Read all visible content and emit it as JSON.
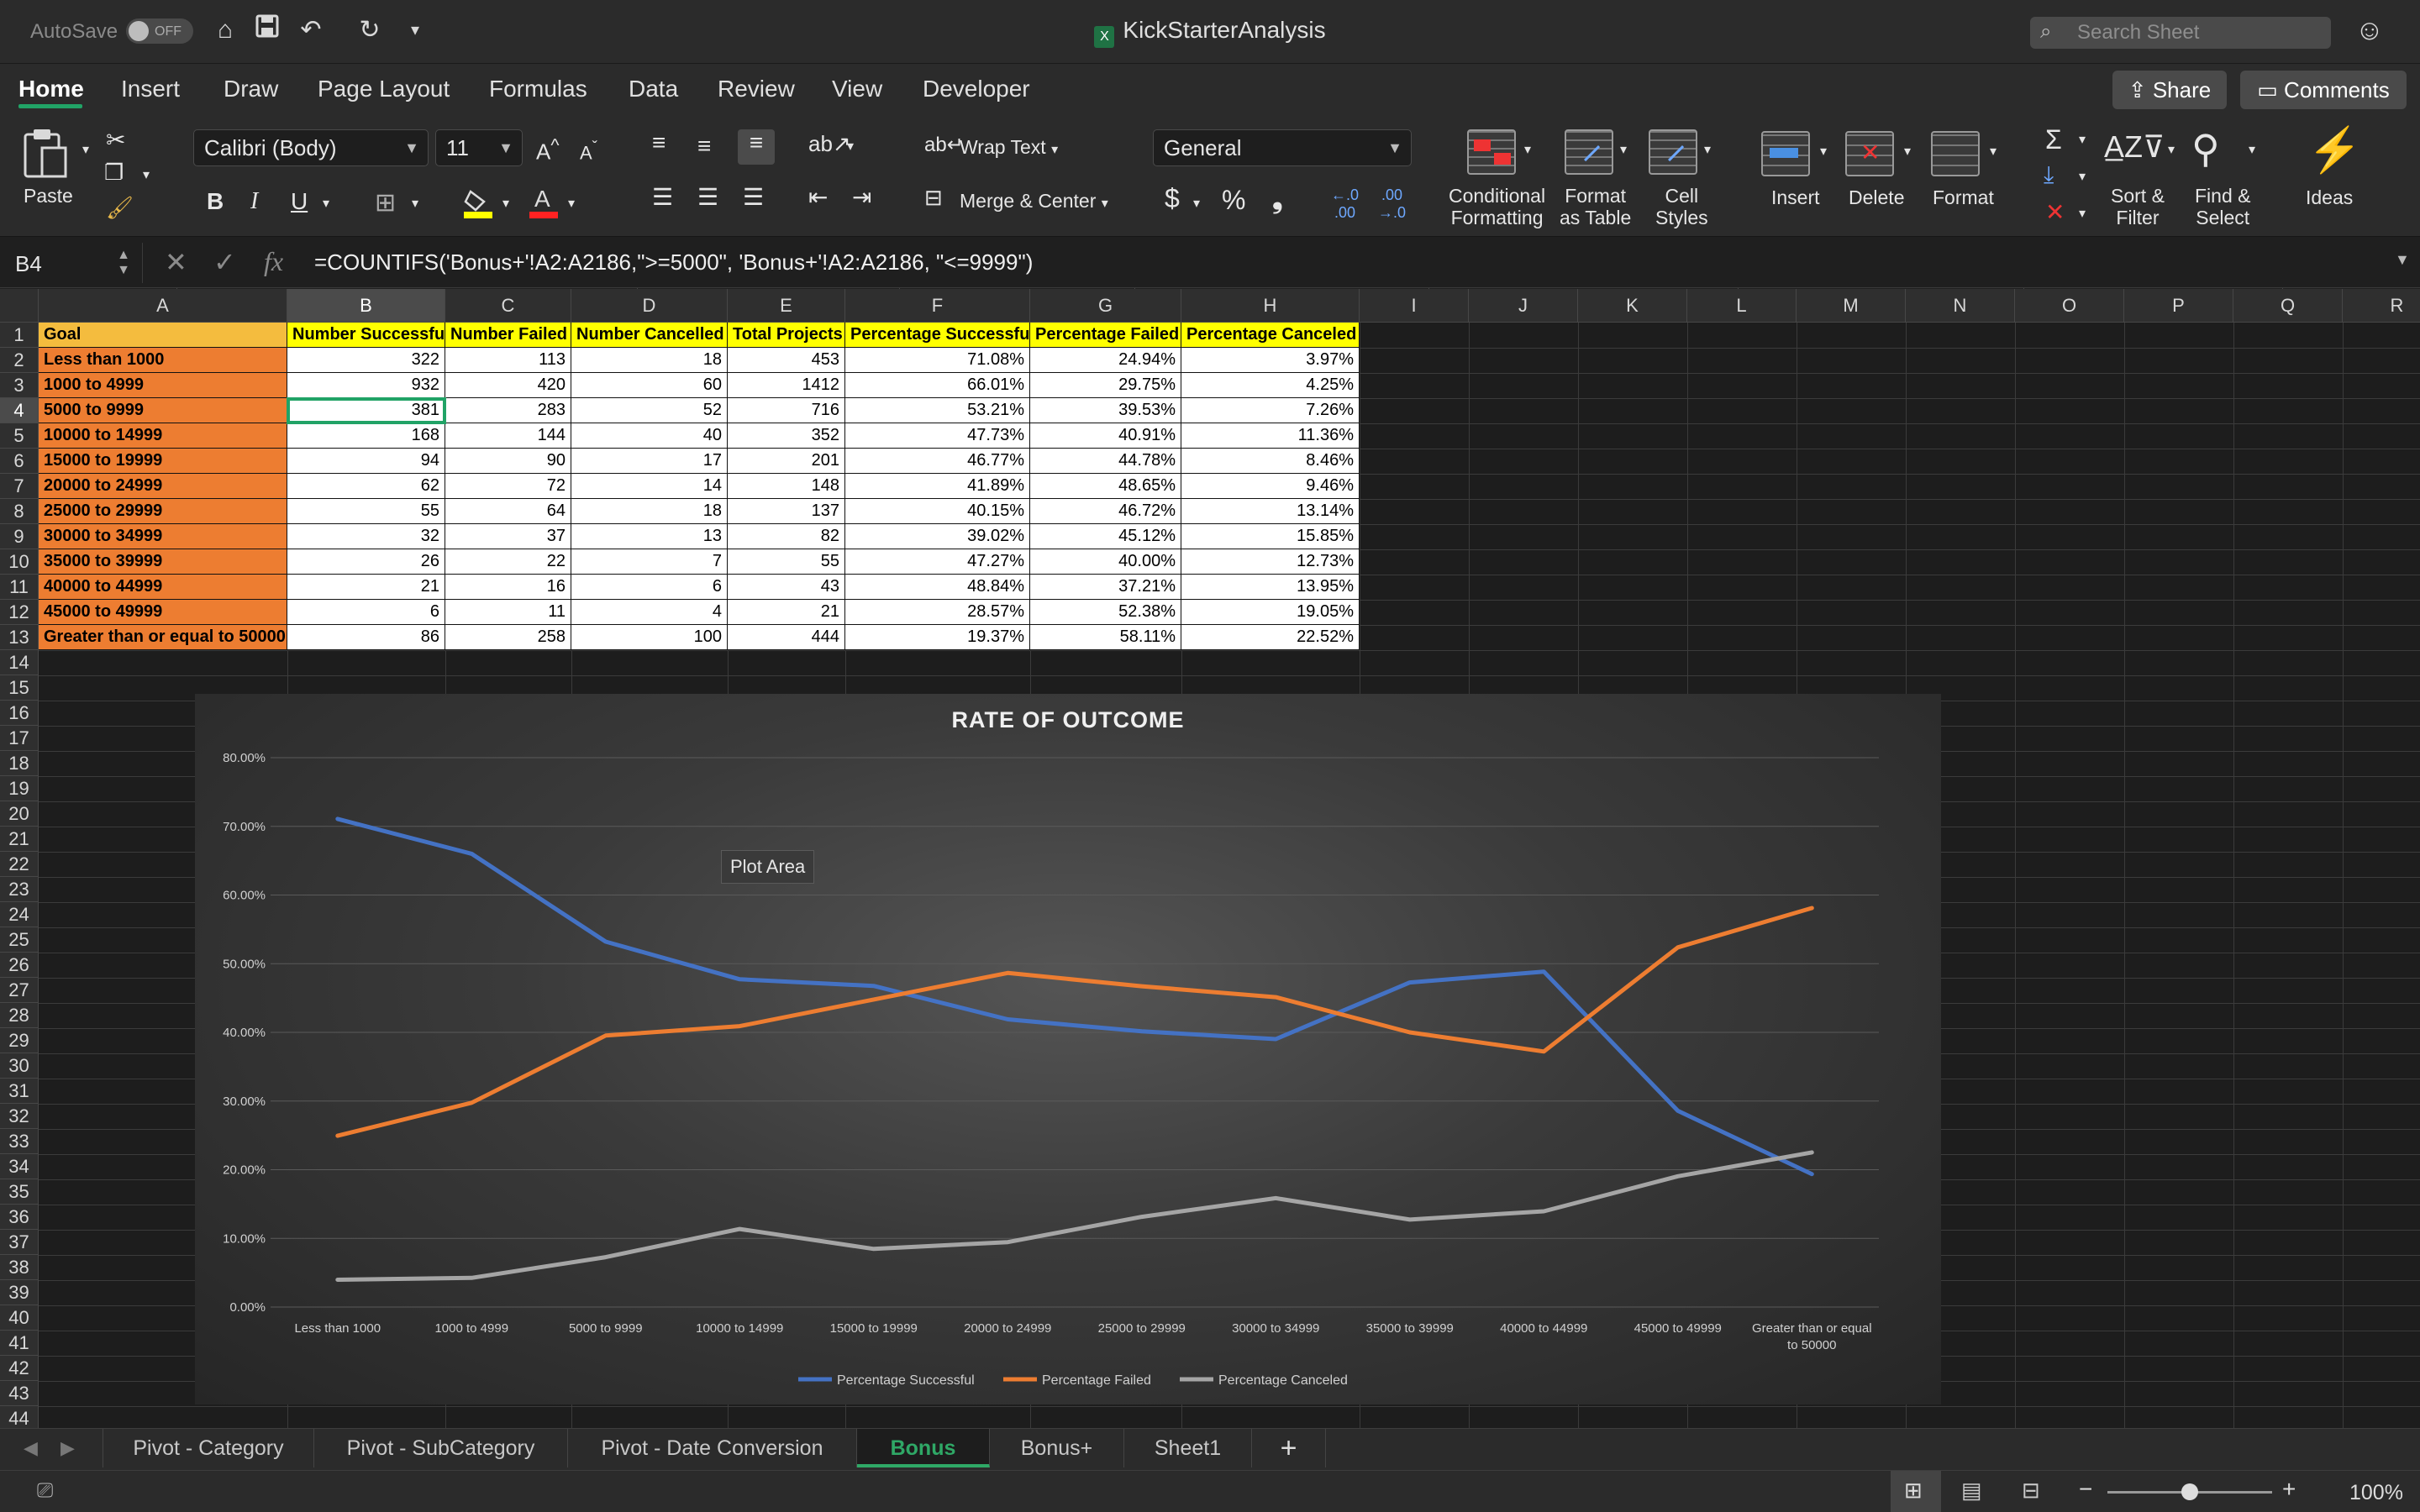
{
  "titlebar": {
    "autosave_label": "AutoSave",
    "autosave_state": "OFF",
    "title": "KickStarterAnalysis",
    "search_placeholder": "Search Sheet"
  },
  "ribbon_tabs": [
    "Home",
    "Insert",
    "Draw",
    "Page Layout",
    "Formulas",
    "Data",
    "Review",
    "View",
    "Developer"
  ],
  "share_label": "Share",
  "comments_label": "Comments",
  "ribbon": {
    "paste": "Paste",
    "font_name": "Calibri (Body)",
    "font_size": "11",
    "wrap_text": "Wrap Text",
    "merge_center": "Merge & Center",
    "number_format": "General",
    "conditional_formatting": [
      "Conditional",
      "Formatting"
    ],
    "format_as_table": [
      "Format",
      "as Table"
    ],
    "cell_styles": [
      "Cell",
      "Styles"
    ],
    "insert": "Insert",
    "delete": "Delete",
    "format": "Format",
    "sort_filter": [
      "Sort &",
      "Filter"
    ],
    "find_select": [
      "Find &",
      "Select"
    ],
    "ideas": "Ideas",
    "bold": "B",
    "italic": "I",
    "underline": "U"
  },
  "formula_bar": {
    "name_box": "B4",
    "fx": "fx",
    "formula": "=COUNTIFS('Bonus+'!A2:A2186,\">=5000\", 'Bonus+'!A2:A2186, \"<=9999\")"
  },
  "columns": [
    "A",
    "B",
    "C",
    "D",
    "E",
    "F",
    "G",
    "H",
    "I",
    "J",
    "K",
    "L",
    "M",
    "N",
    "O",
    "P",
    "Q",
    "R"
  ],
  "table": {
    "headers": [
      "Goal",
      "Number Successful",
      "Number Failed",
      "Number Cancelled",
      "Total Projects",
      "Percentage Successful",
      "Percentage Failed",
      "Percentage Canceled"
    ],
    "rows": [
      [
        "Less than 1000",
        "322",
        "113",
        "18",
        "453",
        "71.08%",
        "24.94%",
        "3.97%"
      ],
      [
        "1000 to 4999",
        "932",
        "420",
        "60",
        "1412",
        "66.01%",
        "29.75%",
        "4.25%"
      ],
      [
        "5000 to 9999",
        "381",
        "283",
        "52",
        "716",
        "53.21%",
        "39.53%",
        "7.26%"
      ],
      [
        "10000 to 14999",
        "168",
        "144",
        "40",
        "352",
        "47.73%",
        "40.91%",
        "11.36%"
      ],
      [
        "15000 to 19999",
        "94",
        "90",
        "17",
        "201",
        "46.77%",
        "44.78%",
        "8.46%"
      ],
      [
        "20000 to 24999",
        "62",
        "72",
        "14",
        "148",
        "41.89%",
        "48.65%",
        "9.46%"
      ],
      [
        "25000 to 29999",
        "55",
        "64",
        "18",
        "137",
        "40.15%",
        "46.72%",
        "13.14%"
      ],
      [
        "30000 to 34999",
        "32",
        "37",
        "13",
        "82",
        "39.02%",
        "45.12%",
        "15.85%"
      ],
      [
        "35000 to 39999",
        "26",
        "22",
        "7",
        "55",
        "47.27%",
        "40.00%",
        "12.73%"
      ],
      [
        "40000 to 44999",
        "21",
        "16",
        "6",
        "43",
        "48.84%",
        "37.21%",
        "13.95%"
      ],
      [
        "45000 to 49999",
        "6",
        "11",
        "4",
        "21",
        "28.57%",
        "52.38%",
        "19.05%"
      ],
      [
        "Greater than or equal to 50000",
        "86",
        "258",
        "100",
        "444",
        "19.37%",
        "58.11%",
        "22.52%"
      ]
    ]
  },
  "tooltip": "Plot Area",
  "chart_data": {
    "type": "line",
    "title": "RATE OF OUTCOME",
    "categories": [
      "Less than 1000",
      "1000 to 4999",
      "5000 to 9999",
      "10000 to 14999",
      "15000 to 19999",
      "20000 to 24999",
      "25000 to 29999",
      "30000 to 34999",
      "35000 to 39999",
      "40000 to 44999",
      "45000 to 49999",
      "Greater than or equal to 50000"
    ],
    "series": [
      {
        "name": "Percentage Successful",
        "color": "#4472c4",
        "values": [
          71.08,
          66.01,
          53.21,
          47.73,
          46.77,
          41.89,
          40.15,
          39.02,
          47.27,
          48.84,
          28.57,
          19.37
        ]
      },
      {
        "name": "Percentage Failed",
        "color": "#ed7d31",
        "values": [
          24.94,
          29.75,
          39.53,
          40.91,
          44.78,
          48.65,
          46.72,
          45.12,
          40.0,
          37.21,
          52.38,
          58.11
        ]
      },
      {
        "name": "Percentage Canceled",
        "color": "#a5a5a5",
        "values": [
          3.97,
          4.25,
          7.26,
          11.36,
          8.46,
          9.46,
          13.14,
          15.85,
          12.73,
          13.95,
          19.05,
          22.52
        ]
      }
    ],
    "yticks": [
      "0.00%",
      "10.00%",
      "20.00%",
      "30.00%",
      "40.00%",
      "50.00%",
      "60.00%",
      "70.00%",
      "80.00%"
    ],
    "ylim": [
      0,
      80
    ],
    "legend": "bottom",
    "grid": true
  },
  "sheet_tabs": [
    "Pivot - Category",
    "Pivot - SubCategory",
    "Pivot - Date Conversion",
    "Bonus",
    "Bonus+",
    "Sheet1"
  ],
  "active_sheet": "Bonus",
  "zoom": "100%"
}
